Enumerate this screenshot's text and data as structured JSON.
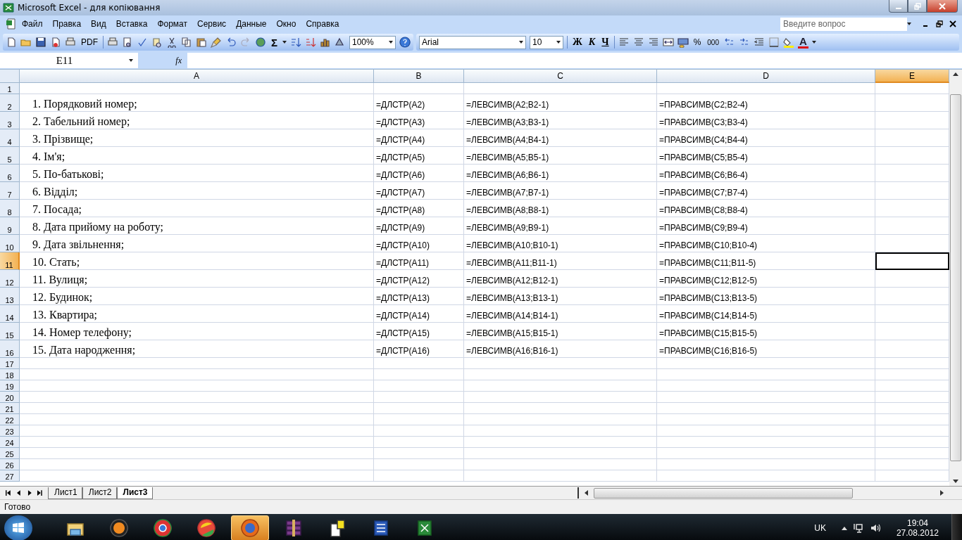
{
  "window": {
    "title": "Microsoft Excel - для копіювання"
  },
  "menu": [
    "Файл",
    "Правка",
    "Вид",
    "Вставка",
    "Формат",
    "Сервис",
    "Данные",
    "Окно",
    "Справка"
  ],
  "help_search": {
    "placeholder": "Введите вопрос"
  },
  "toolbar": {
    "pdf_label": "PDF",
    "autosum_label": "Σ",
    "zoom": "100%",
    "font": "Arial",
    "font_size": "10",
    "bold_label": "Ж",
    "italic_label": "К",
    "underline_label": "Ч",
    "percent_label": "%",
    "thousands_label": "000",
    "font_color_label": "A"
  },
  "formula_bar": {
    "name_box": "E11",
    "fx_label": "fx"
  },
  "columns": [
    {
      "label": "A",
      "selected": false
    },
    {
      "label": "B",
      "selected": false
    },
    {
      "label": "C",
      "selected": false
    },
    {
      "label": "D",
      "selected": false
    },
    {
      "label": "E",
      "selected": true
    }
  ],
  "rows": [
    {
      "number": "1",
      "selected": false
    },
    {
      "number": "2",
      "selected": false,
      "cells": [
        "1. Порядковий номер;",
        "=ДЛСТР(A2)",
        "=ЛЕВСИМВ(A2;B2-1)",
        "=ПРАВСИМВ(C2;B2-4)"
      ]
    },
    {
      "number": "3",
      "selected": false,
      "cells": [
        "2. Табельний номер;",
        "=ДЛСТР(A3)",
        "=ЛЕВСИМВ(A3;B3-1)",
        "=ПРАВСИМВ(C3;B3-4)"
      ]
    },
    {
      "number": "4",
      "selected": false,
      "cells": [
        "3. Прізвище;",
        "=ДЛСТР(A4)",
        "=ЛЕВСИМВ(A4;B4-1)",
        "=ПРАВСИМВ(C4;B4-4)"
      ]
    },
    {
      "number": "5",
      "selected": false,
      "cells": [
        "4. Ім'я;",
        "=ДЛСТР(A5)",
        "=ЛЕВСИМВ(A5;B5-1)",
        "=ПРАВСИМВ(C5;B5-4)"
      ]
    },
    {
      "number": "6",
      "selected": false,
      "cells": [
        "5. По-батькові;",
        "=ДЛСТР(A6)",
        "=ЛЕВСИМВ(A6;B6-1)",
        "=ПРАВСИМВ(C6;B6-4)"
      ]
    },
    {
      "number": "7",
      "selected": false,
      "cells": [
        "6. Відділ;",
        "=ДЛСТР(A7)",
        "=ЛЕВСИМВ(A7;B7-1)",
        "=ПРАВСИМВ(C7;B7-4)"
      ]
    },
    {
      "number": "8",
      "selected": false,
      "cells": [
        "7. Посада;",
        "=ДЛСТР(A8)",
        "=ЛЕВСИМВ(A8;B8-1)",
        "=ПРАВСИМВ(C8;B8-4)"
      ]
    },
    {
      "number": "9",
      "selected": false,
      "cells": [
        "8. Дата прийому на роботу;",
        "=ДЛСТР(A9)",
        "=ЛЕВСИМВ(A9;B9-1)",
        "=ПРАВСИМВ(C9;B9-4)"
      ]
    },
    {
      "number": "10",
      "selected": false,
      "cells": [
        "9. Дата звільнення;",
        "=ДЛСТР(A10)",
        "=ЛЕВСИМВ(A10;B10-1)",
        "=ПРАВСИМВ(C10;B10-4)"
      ]
    },
    {
      "number": "11",
      "selected": true,
      "cells": [
        "10. Стать;",
        "=ДЛСТР(A11)",
        "=ЛЕВСИМВ(A11;B11-1)",
        "=ПРАВСИМВ(C11;B11-5)"
      ]
    },
    {
      "number": "12",
      "selected": false,
      "cells": [
        "11. Вулиця;",
        "=ДЛСТР(A12)",
        "=ЛЕВСИМВ(A12;B12-1)",
        "=ПРАВСИМВ(C12;B12-5)"
      ]
    },
    {
      "number": "13",
      "selected": false,
      "cells": [
        "12. Будинок;",
        "=ДЛСТР(A13)",
        "=ЛЕВСИМВ(A13;B13-1)",
        "=ПРАВСИМВ(C13;B13-5)"
      ]
    },
    {
      "number": "14",
      "selected": false,
      "cells": [
        "13. Квартира;",
        "=ДЛСТР(A14)",
        "=ЛЕВСИМВ(A14;B14-1)",
        "=ПРАВСИМВ(C14;B14-5)"
      ]
    },
    {
      "number": "15",
      "selected": false,
      "cells": [
        "14. Номер телефону;",
        "=ДЛСТР(A15)",
        "=ЛЕВСИМВ(A15;B15-1)",
        "=ПРАВСИМВ(C15;B15-5)"
      ]
    },
    {
      "number": "16",
      "selected": false,
      "cells": [
        "15. Дата народження;",
        "=ДЛСТР(A16)",
        "=ЛЕВСИМВ(A16;B16-1)",
        "=ПРАВСИМВ(C16;B16-5)"
      ]
    },
    {
      "number": "17",
      "selected": false
    },
    {
      "number": "18",
      "selected": false
    },
    {
      "number": "19",
      "selected": false
    },
    {
      "number": "20",
      "selected": false
    },
    {
      "number": "21",
      "selected": false
    },
    {
      "number": "22",
      "selected": false
    },
    {
      "number": "23",
      "selected": false
    },
    {
      "number": "24",
      "selected": false
    },
    {
      "number": "25",
      "selected": false
    },
    {
      "number": "26",
      "selected": false
    },
    {
      "number": "27",
      "selected": false
    }
  ],
  "sheet_tabs": [
    {
      "label": "Лист1",
      "selected": false
    },
    {
      "label": "Лист2",
      "selected": false
    },
    {
      "label": "Лист3",
      "selected": true
    }
  ],
  "status_bar": {
    "text": "Готово"
  },
  "taskbar": {
    "apps": [
      {
        "kind": "explorer",
        "selected": false
      },
      {
        "kind": "aimp",
        "selected": false
      },
      {
        "kind": "chrome",
        "selected": false
      },
      {
        "kind": "ball",
        "selected": false
      },
      {
        "kind": "firefox",
        "selected": true
      },
      {
        "kind": "archiver",
        "selected": false
      },
      {
        "kind": "help",
        "selected": false
      },
      {
        "kind": "word",
        "selected": false
      },
      {
        "kind": "excel",
        "selected": false
      }
    ],
    "language": "UK",
    "time": "19:04",
    "date": "27.08.2012"
  }
}
